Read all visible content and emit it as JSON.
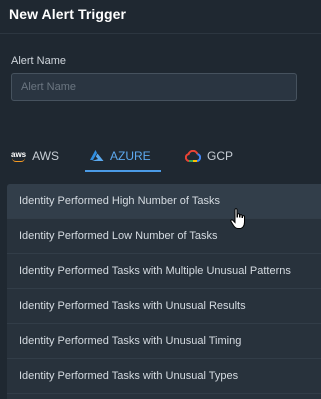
{
  "header": {
    "title": "New Alert Trigger"
  },
  "form": {
    "alert_name_label": "Alert Name",
    "alert_name_placeholder": "Alert Name",
    "alert_name_value": ""
  },
  "tabs": [
    {
      "label": "AWS",
      "icon": "aws-icon",
      "active": false
    },
    {
      "label": "AZURE",
      "icon": "azure-icon",
      "active": true
    },
    {
      "label": "GCP",
      "icon": "gcp-icon",
      "active": false
    }
  ],
  "list": {
    "items": [
      {
        "label": "Identity Performed High Number of Tasks",
        "hovered": true
      },
      {
        "label": "Identity Performed Low Number of Tasks"
      },
      {
        "label": "Identity Performed Tasks with Multiple Unusual Patterns"
      },
      {
        "label": "Identity Performed Tasks with Unusual Results"
      },
      {
        "label": "Identity Performed Tasks with Unusual Timing"
      },
      {
        "label": "Identity Performed Tasks with Unusual Types"
      }
    ]
  },
  "colors": {
    "background": "#1f2831",
    "accent": "#4b9be6",
    "list_background": "#28323c"
  }
}
